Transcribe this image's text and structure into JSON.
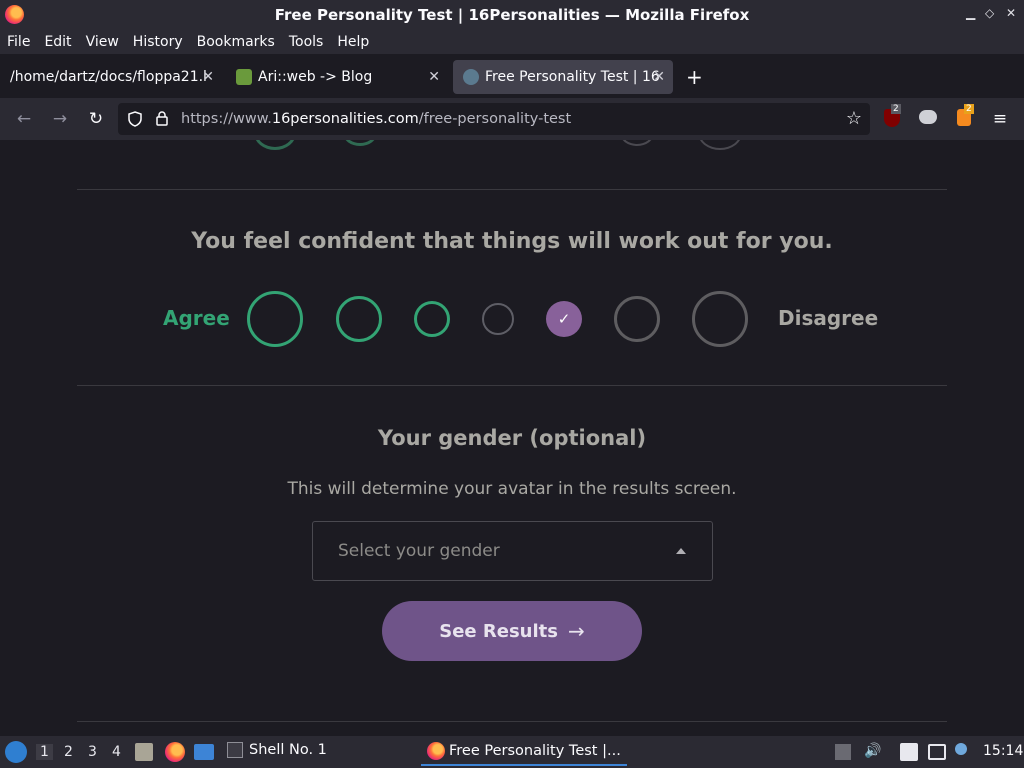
{
  "window": {
    "title": "Free Personality Test | 16Personalities — Mozilla Firefox"
  },
  "menu": [
    "File",
    "Edit",
    "View",
    "History",
    "Bookmarks",
    "Tools",
    "Help"
  ],
  "tabs": [
    {
      "label": "/home/dartz/docs/floppa21.l",
      "active": false
    },
    {
      "label": "Ari::web -> Blog",
      "active": false
    },
    {
      "label": "Free Personality Test | 16",
      "active": true
    }
  ],
  "new_tab": "+",
  "url": {
    "prefix": "https://www.",
    "domain": "16personalities.com",
    "path": "/free-personality-test"
  },
  "badges": {
    "ublock": "2",
    "ext": "2"
  },
  "question": {
    "text": "You feel confident that things will work out for you.",
    "agree_label": "Agree",
    "disagree_label": "Disagree",
    "selected_index": 4
  },
  "gender": {
    "title": "Your gender (optional)",
    "subtitle": "This will determine your avatar in the results screen.",
    "placeholder": "Select your gender"
  },
  "results_button": {
    "label": "See Results",
    "arrow": "→"
  },
  "taskbar": {
    "workspaces": [
      "1",
      "2",
      "3",
      "4"
    ],
    "active_workspace": "1",
    "tasks": [
      "Shell No. 1",
      "Free Personality Test |..."
    ],
    "clock": "15:14"
  },
  "colors": {
    "agree": "#33a474",
    "disagree": "#88619a",
    "neutral": "#9b9faa",
    "button": "#6f5489"
  }
}
